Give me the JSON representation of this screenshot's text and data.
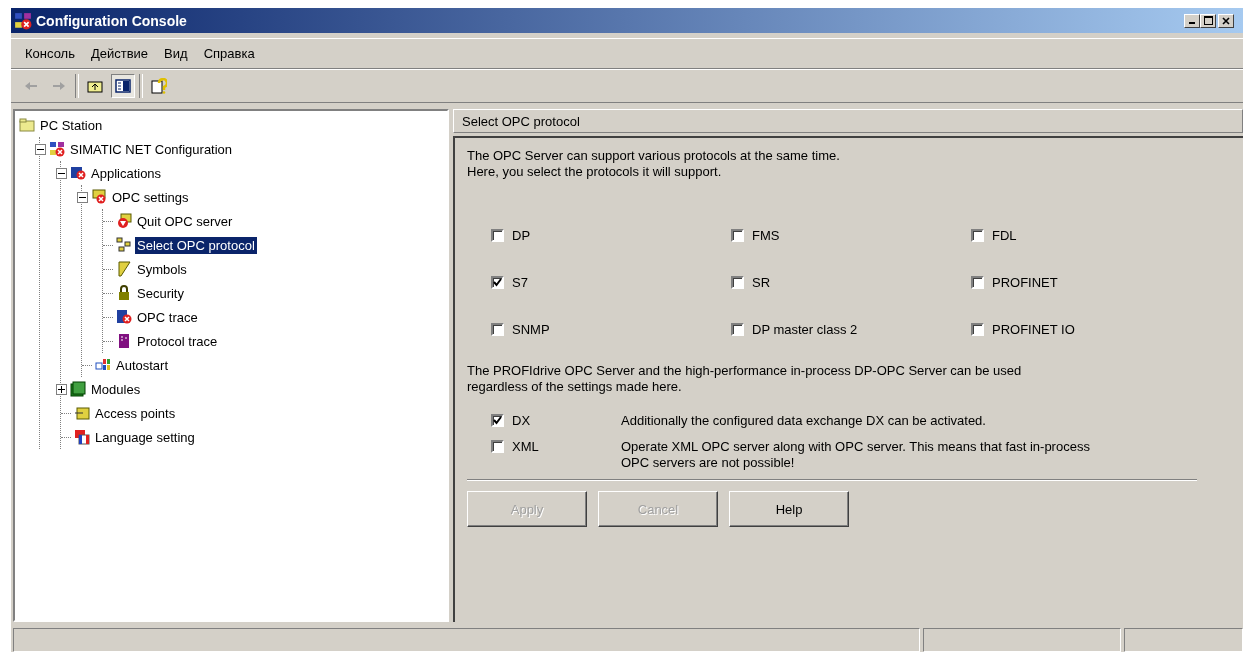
{
  "window": {
    "title": "Configuration Console"
  },
  "menu": [
    "Консоль",
    "Действие",
    "Вид",
    "Справка"
  ],
  "toolbar": [
    {
      "kind": "back",
      "disabled": true
    },
    {
      "kind": "forward",
      "disabled": true
    },
    {
      "kind": "separator"
    },
    {
      "kind": "up",
      "pressed": false
    },
    {
      "kind": "tree",
      "pressed": true
    },
    {
      "kind": "separator"
    },
    {
      "kind": "help",
      "pressed": false
    }
  ],
  "tree": [
    {
      "label": "PC Station",
      "selected": false,
      "children": [
        {
          "label": "SIMATIC NET Configuration",
          "selected": false,
          "expanded": true,
          "children": [
            {
              "label": "Applications",
              "selected": false,
              "expanded": true,
              "children": [
                {
                  "label": "OPC settings",
                  "selected": false,
                  "expanded": true,
                  "children": [
                    {
                      "label": "Quit OPC server",
                      "selected": false
                    },
                    {
                      "label": "Select OPC protocol",
                      "selected": true
                    },
                    {
                      "label": "Symbols",
                      "selected": false
                    },
                    {
                      "label": "Security",
                      "selected": false
                    },
                    {
                      "label": "OPC trace",
                      "selected": false
                    },
                    {
                      "label": "Protocol trace",
                      "selected": false
                    }
                  ]
                },
                {
                  "label": "Autostart",
                  "selected": false
                }
              ]
            },
            {
              "label": "Modules",
              "selected": false,
              "expanded": false
            },
            {
              "label": "Access points",
              "selected": false
            },
            {
              "label": "Language setting",
              "selected": false
            }
          ]
        }
      ]
    }
  ],
  "panel": {
    "header": "Select OPC protocol",
    "intro": [
      "The OPC Server can support various protocols at the same time.",
      "Here, you select the protocols it will support."
    ],
    "protocols": [
      {
        "label": "DP",
        "checked": false
      },
      {
        "label": "FMS",
        "checked": false
      },
      {
        "label": "FDL",
        "checked": false
      },
      {
        "label": "S7",
        "checked": true
      },
      {
        "label": "SR",
        "checked": false
      },
      {
        "label": "PROFINET",
        "checked": false
      },
      {
        "label": "SNMP",
        "checked": false
      },
      {
        "label": "DP master class 2",
        "checked": false
      },
      {
        "label": "PROFINET IO",
        "checked": false
      }
    ],
    "note": [
      "The PROFIdrive OPC Server and the high-performance in-process DP-OPC Server can be used",
      "regardless of the settings made here."
    ],
    "options": [
      {
        "label": "DX",
        "checked": true,
        "description": [
          "Additionally the configured data exchange DX can be activated."
        ]
      },
      {
        "label": "XML",
        "checked": false,
        "description": [
          "Operate XML OPC server along with OPC server. This means that fast in-process",
          "OPC servers are not possible!"
        ]
      }
    ],
    "buttons": [
      {
        "label": "Apply",
        "disabled": true
      },
      {
        "label": "Cancel",
        "disabled": true
      },
      {
        "label": "Help",
        "disabled": false
      }
    ]
  }
}
